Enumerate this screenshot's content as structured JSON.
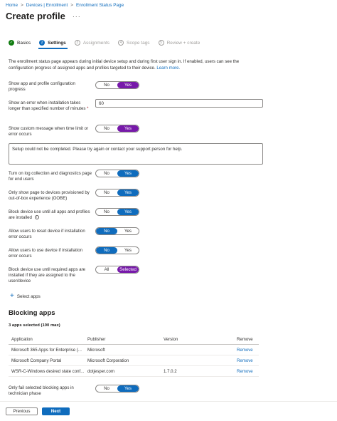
{
  "breadcrumb": {
    "items": [
      "Home",
      "Devices | Enrollment",
      "Enrollment Status Page"
    ]
  },
  "header": {
    "title": "Create profile",
    "more_icon": "more-icon"
  },
  "wizard": {
    "steps": [
      {
        "label": "Basics",
        "state": "done",
        "marker": "✓"
      },
      {
        "label": "Settings",
        "state": "current",
        "marker": "2"
      },
      {
        "label": "Assignments",
        "state": "todo",
        "marker": "3"
      },
      {
        "label": "Scope tags",
        "state": "todo",
        "marker": "4"
      },
      {
        "label": "Review + create",
        "state": "todo",
        "marker": "5"
      }
    ]
  },
  "description": {
    "text": "The enrollment status page appears during initial device setup and during first user sign in. If enabled, users can see the configuration progress of assigned apps and profiles targeted to their device.",
    "link": "Learn more."
  },
  "settings": {
    "show_progress": {
      "label": "Show app and profile configuration progress",
      "off": "No",
      "on": "Yes",
      "selected": "Yes"
    },
    "timeout": {
      "label": "Show an error when installation takes longer than specified number of minutes",
      "value": "60",
      "required_mark": "*"
    },
    "custom_message": {
      "label": "Show custom message when time limit or error occurs",
      "off": "No",
      "on": "Yes",
      "selected": "Yes"
    },
    "message_text": "Setup could not be completed. Please try again or contact your support person for help.",
    "log_collection": {
      "label": "Turn on log collection and diagnostics page for end users",
      "off": "No",
      "on": "Yes",
      "selected": "Yes"
    },
    "oobe_only": {
      "label": "Only show page to devices provisioned by out-of-box experience (OOBE)",
      "off": "No",
      "on": "Yes",
      "selected": "Yes"
    },
    "block_until_all": {
      "label": "Block device use until all apps and profiles are installed",
      "off": "No",
      "on": "Yes",
      "selected": "Yes"
    },
    "allow_reset": {
      "label": "Allow users to reset device if installation error occurs",
      "off": "No",
      "on": "Yes",
      "selected": "No"
    },
    "allow_use": {
      "label": "Allow users to use device if installation error occurs",
      "off": "No",
      "on": "Yes",
      "selected": "No"
    },
    "block_required": {
      "label": "Block device use until required apps are installed if they are assigned to the user/device",
      "off": "All",
      "on": "Selected",
      "selected": "Selected"
    }
  },
  "select_apps": "Select apps",
  "blocking_apps": {
    "title": "Blocking apps",
    "count_text": "3 apps selected (100 max)",
    "columns": [
      "Application",
      "Publisher",
      "Version",
      "Remove"
    ],
    "rows": [
      {
        "application": "Microsoft 365 Apps for Enterprise (...",
        "publisher": "Microsoft",
        "version": "",
        "remove": "Remove"
      },
      {
        "application": "Microsoft Company Portal",
        "publisher": "Microsoft Corporation",
        "version": "",
        "remove": "Remove"
      },
      {
        "application": "WSR-C-Windows desired state conf...",
        "publisher": "dotjesper.com",
        "version": "1.7.0.2",
        "remove": "Remove"
      }
    ]
  },
  "technician_phase": {
    "label": "Only fail selected blocking apps in technician phase",
    "off": "No",
    "on": "Yes",
    "selected": "Yes"
  },
  "footer": {
    "previous": "Previous",
    "next": "Next"
  },
  "colors": {
    "accent": "#0f6cbd",
    "toggle_purple": "#7719aa",
    "success": "#107c10"
  }
}
